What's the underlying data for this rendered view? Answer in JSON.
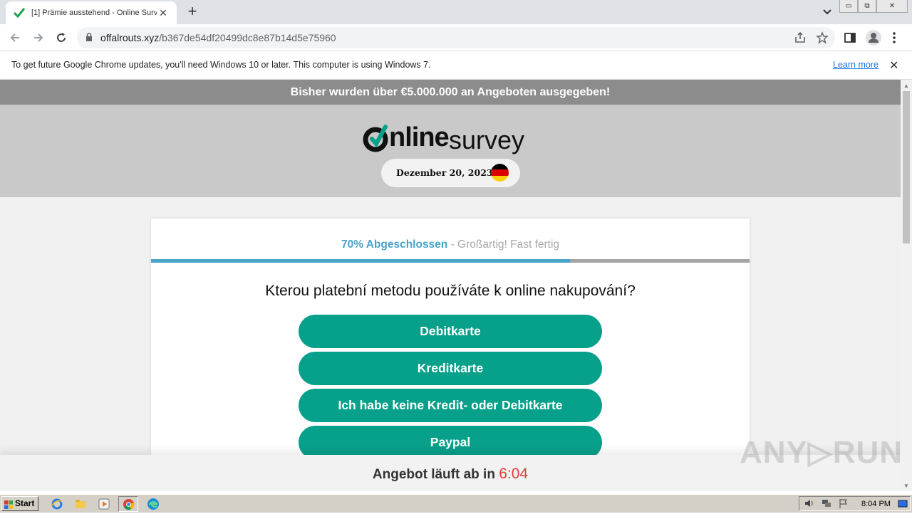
{
  "browser": {
    "tab_title": "[1] Prämie ausstehend - Online Survey",
    "url_domain": "offalrouts.xyz",
    "url_path": "/b367de54df20499dc8e87b14d5e75960",
    "window_buttons": [
      "▭",
      "⧉",
      "✕"
    ]
  },
  "infobar": {
    "message": "To get future Google Chrome updates, you'll need Windows 10 or later. This computer is using Windows 7.",
    "link": "Learn more"
  },
  "page": {
    "banner": "Bisher wurden über €5.000.000 an Angeboten ausgegeben!",
    "logo_online": "nline",
    "logo_survey": "survey",
    "date": "Dezember 20, 2023",
    "progress_strong": "70% Abgeschlossen",
    "progress_rest": " - Großartig! Fast fertig",
    "progress_value": 0.7,
    "question": "Kterou platební metodu používáte k online nakupování?",
    "options": [
      "Debitkarte",
      "Kreditkarte",
      "Ich habe keine Kredit- oder Debitkarte",
      "Paypal"
    ],
    "footer_text": "Angebot läuft ab in ",
    "footer_time": "6:04",
    "watermark": "ANY▷RUN"
  },
  "taskbar": {
    "start": "Start",
    "clock": "8:04 PM"
  },
  "colors": {
    "accent_teal": "#07a08a",
    "progress_blue": "#4aa3c9",
    "timer_red": "#e23b3b"
  }
}
